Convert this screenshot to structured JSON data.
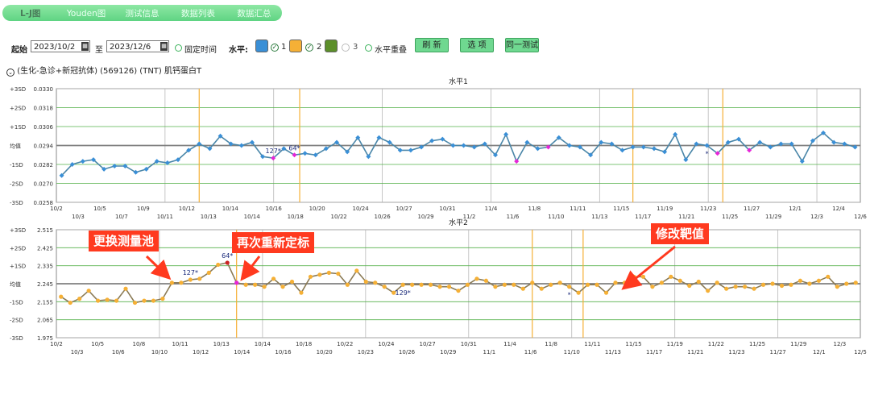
{
  "tabs": [
    {
      "label": "L-J图",
      "active": true
    },
    {
      "label": "Youden图"
    },
    {
      "label": "测试信息"
    },
    {
      "label": "数据列表"
    },
    {
      "label": "数据汇总"
    }
  ],
  "toolbar": {
    "start_label": "起始",
    "start_date": "2023/10/2",
    "to_label": "至",
    "end_date": "2023/12/6",
    "fixed_time_label": "固定时间",
    "level_label": "水平:",
    "levels": [
      {
        "label": "1",
        "color": "#3a8fd6",
        "checked": true
      },
      {
        "label": "2",
        "color": "#f5b036",
        "checked": true
      },
      {
        "label": "3",
        "color": "#5c8f2a",
        "checked": false
      }
    ],
    "overlap_label": "水平重叠",
    "refresh_label": "刷 新",
    "options_label": "选 项",
    "same_test_label": "同一测试"
  },
  "test_line": "(生化-急诊+新冠抗体) (569126) (TNT) 肌钙蛋白T",
  "callouts": {
    "a": "更换测量池",
    "b": "再次重新定标",
    "c": "修改靶值"
  },
  "chart_data": [
    {
      "type": "line",
      "title": "水平1",
      "sd_labels": [
        "+3SD",
        "+2SD",
        "+1SD",
        "均值",
        "-1SD",
        "-2SD",
        "-3SD"
      ],
      "y_ticks": [
        "0.0330",
        "0.0318",
        "0.0306",
        "0.0294",
        "0.0282",
        "0.0270",
        "0.0258"
      ],
      "ylim": [
        0.0258,
        0.033
      ],
      "mean": 0.0294,
      "line_color": "#4a86a8",
      "marker_color": "#3a8fd6",
      "x_labels": [
        "10/2",
        "10/3",
        "10/5",
        "10/7",
        "10/9",
        "10/11",
        "10/12",
        "10/13",
        "10/14",
        "10/14",
        "10/16",
        "10/18",
        "10/20",
        "10/22",
        "10/24",
        "10/26",
        "10/27",
        "10/29",
        "10/31",
        "11/2",
        "11/4",
        "11/6",
        "11/8",
        "11/10",
        "11/11",
        "11/13",
        "11/15",
        "11/17",
        "11/19",
        "11/21",
        "11/23",
        "11/25",
        "11/27",
        "11/29",
        "12/1",
        "12/3",
        "12/4",
        "12/6"
      ],
      "values": [
        0.0275,
        0.0282,
        0.0284,
        0.0285,
        0.0279,
        0.0281,
        0.0281,
        0.0277,
        0.0279,
        0.0284,
        0.0283,
        0.0285,
        0.0291,
        0.0295,
        0.0292,
        0.03,
        0.0295,
        0.0294,
        0.0296,
        0.0287,
        0.0286,
        0.0292,
        0.0288,
        0.0289,
        0.0288,
        0.0292,
        0.0296,
        0.029,
        0.0299,
        0.0287,
        0.0299,
        0.0296,
        0.0291,
        0.0291,
        0.0293,
        0.0297,
        0.0298,
        0.0294,
        0.0294,
        0.0293,
        0.0295,
        0.0288,
        0.0301,
        0.0284,
        0.0296,
        0.0292,
        0.0293,
        0.0299,
        0.0294,
        0.0293,
        0.0288,
        0.0296,
        0.0295,
        0.0291,
        0.0293,
        0.0293,
        0.0292,
        0.029,
        0.0301,
        0.0285,
        0.0295,
        0.0294,
        0.0289,
        0.0296,
        0.0298,
        0.0291,
        0.0296,
        0.0293,
        0.0295,
        0.0295,
        0.0284,
        0.0297,
        0.0302,
        0.0296,
        0.0295,
        0.0293
      ],
      "highlight": [
        {
          "i": 20,
          "color": "#e626d8"
        },
        {
          "i": 22,
          "color": "#e626d8"
        },
        {
          "i": 43,
          "color": "#e626d8"
        },
        {
          "i": 46,
          "color": "#e626d8"
        },
        {
          "i": 62,
          "color": "#e626d8"
        },
        {
          "i": 65,
          "color": "#e626d8"
        }
      ],
      "annotations": [
        {
          "i": 20,
          "text": "127*"
        },
        {
          "i": 22,
          "text": "64*"
        },
        {
          "i": 61,
          "text": "*"
        }
      ],
      "vlines": [
        {
          "pos": 13.0,
          "color": "#f5b036"
        },
        {
          "pos": 22.5,
          "color": "#f5b036"
        },
        {
          "pos": 54.0,
          "color": "#f5b036"
        },
        {
          "pos": 62.5,
          "color": "#f5b036"
        }
      ]
    },
    {
      "type": "line",
      "title": "水平2",
      "sd_labels": [
        "+3SD",
        "+2SD",
        "+1SD",
        "均值",
        "-1SD",
        "-2SD",
        "-3SD"
      ],
      "y_ticks": [
        "2.515",
        "2.425",
        "2.335",
        "2.245",
        "2.155",
        "2.065",
        "1.975"
      ],
      "ylim": [
        1.975,
        2.515
      ],
      "mean": 2.245,
      "line_color": "#8a7a55",
      "marker_color": "#f5b036",
      "x_labels": [
        "10/2",
        "10/3",
        "10/5",
        "10/6",
        "10/8",
        "10/10",
        "10/11",
        "10/12",
        "10/13",
        "10/14",
        "10/14",
        "10/16",
        "10/18",
        "10/20",
        "10/22",
        "10/23",
        "10/24",
        "10/26",
        "10/27",
        "10/29",
        "10/31",
        "11/1",
        "11/4",
        "11/6",
        "11/8",
        "11/10",
        "11/11",
        "11/13",
        "11/15",
        "11/17",
        "11/19",
        "11/21",
        "11/22",
        "11/23",
        "11/25",
        "11/27",
        "11/29",
        "12/1",
        "12/3",
        "12/5"
      ],
      "values": [
        2.18,
        2.15,
        2.17,
        2.21,
        2.16,
        2.165,
        2.16,
        2.22,
        2.15,
        2.16,
        2.16,
        2.17,
        2.25,
        2.25,
        2.265,
        2.27,
        2.3,
        2.34,
        2.35,
        2.25,
        2.24,
        2.24,
        2.23,
        2.27,
        2.23,
        2.255,
        2.2,
        2.28,
        2.29,
        2.3,
        2.295,
        2.24,
        2.31,
        2.255,
        2.25,
        2.23,
        2.2,
        2.24,
        2.24,
        2.24,
        2.24,
        2.23,
        2.23,
        2.21,
        2.24,
        2.27,
        2.26,
        2.23,
        2.24,
        2.24,
        2.22,
        2.25,
        2.22,
        2.24,
        2.25,
        2.23,
        2.2,
        2.24,
        2.24,
        2.2,
        2.25,
        2.25,
        2.28,
        2.28,
        2.23,
        2.25,
        2.28,
        2.26,
        2.235,
        2.255,
        2.21,
        2.25,
        2.22,
        2.23,
        2.23,
        2.22,
        2.24,
        2.245,
        2.235,
        2.24,
        2.26,
        2.245,
        2.26,
        2.28,
        2.23,
        2.245,
        2.25
      ],
      "highlight": [
        {
          "i": 18,
          "color": "#cc2222"
        },
        {
          "i": 19,
          "color": "#e626d8"
        }
      ],
      "annotations": [
        {
          "i": 14,
          "text": "127*"
        },
        {
          "i": 18,
          "text": "64*"
        },
        {
          "i": 37,
          "text": "129*"
        },
        {
          "i": 55,
          "text": "*"
        }
      ],
      "vlines": [
        {
          "pos": 19.0,
          "color": "#f5b036"
        },
        {
          "pos": 51.0,
          "color": "#f5b036"
        },
        {
          "pos": 56.5,
          "color": "#f5b036"
        }
      ]
    }
  ]
}
